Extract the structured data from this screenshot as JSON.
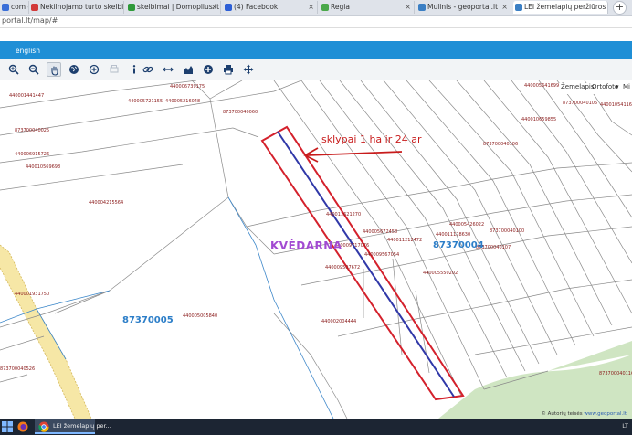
{
  "tabs": [
    {
      "title": "com - C",
      "favicon_color": "#3a6fd8"
    },
    {
      "title": "Nekilnojamo turto skelbimai - Ar",
      "favicon_color": "#d23a3a"
    },
    {
      "title": "skelbimai | Domoplius.lt",
      "favicon_color": "#2f9a3a"
    },
    {
      "title": "(4) Facebook",
      "favicon_color": "#2d5fd6"
    },
    {
      "title": "Regia",
      "favicon_color": "#4aa84a"
    },
    {
      "title": "Mulinis - geoportal.lt",
      "favicon_color": "#3b7fc4"
    },
    {
      "title": "LEI žemelapių peržiūros progra",
      "favicon_color": "#3b7fc4"
    }
  ],
  "url": "portal.lt/map/#",
  "app": {
    "language": "english"
  },
  "toolbar": {
    "icons": [
      "zoom-in-icon",
      "zoom-out-icon",
      "pan-hand-icon",
      "globe-icon",
      "add-location-icon",
      "print-disabled-icon",
      "info-icon",
      "link-icon",
      "measure-distance-icon",
      "chart-icon",
      "add-icon",
      "print-icon",
      "move-icon"
    ]
  },
  "basemaps": {
    "zemelapis": "Žemelapis",
    "ortofoto": "Ortofoto",
    "more": "Mi"
  },
  "map": {
    "place_name": "KVĖDARNA",
    "annotation": "sklypai 1 ha ir 24 ar",
    "area_ids": [
      "87370004",
      "87370005"
    ],
    "parcel_labels": [
      "440001441447",
      "440006739175",
      "440005721155",
      "440005216048",
      "873700040060",
      "873700040025",
      "440006915726",
      "440010569698",
      "440004215564",
      "440011621270",
      "440005672458",
      "440011212472",
      "440005426022",
      "873700040100",
      "440011178630",
      "873700040107",
      "440009717076",
      "440009567054",
      "440009507672",
      "440005550202",
      "440001931750",
      "440002004444",
      "440005005840",
      "440005641699",
      "440010541165",
      "440010659855",
      "873700040106",
      "873700040105",
      "873700040116",
      "873700040526"
    ],
    "attribution": "© Autorių teisės",
    "attribution_link": "www.geoportal.lt"
  },
  "taskbar": {
    "active_label": "LEI žemelapių per...",
    "tray": "LT"
  }
}
